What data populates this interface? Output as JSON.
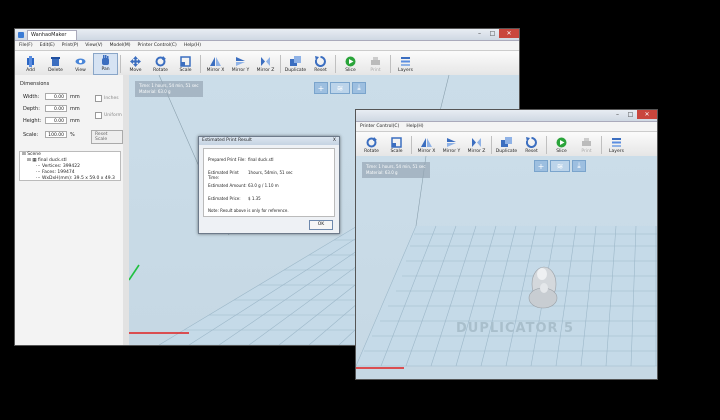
{
  "win1": {
    "title": "WanhaoMaker",
    "menu": [
      "File(F)",
      "Edit(E)",
      "Print(P)",
      "View(V)",
      "Model(M)",
      "Printer Control(C)",
      "Help(H)"
    ],
    "tools": [
      "Add",
      "Delete",
      "View",
      "Pan",
      "Move",
      "Rotate",
      "Scale",
      "Mirror X",
      "Mirror Y",
      "Mirror Z",
      "Duplicate",
      "Reset",
      "Slice",
      "Print",
      "Layers"
    ],
    "sidebar": {
      "heading": "Dimensions",
      "width_label": "Width:",
      "width_value": "0.00",
      "width_unit": "mm",
      "depth_label": "Depth:",
      "depth_value": "0.00",
      "depth_unit": "mm",
      "height_label": "Height:",
      "height_value": "0.00",
      "height_unit": "mm",
      "scale_label": "Scale:",
      "scale_value": "100.00",
      "scale_unit": "%",
      "inches_label": "Inches",
      "uniform_label": "Uniform",
      "reset_scale_label": "Reset Scale",
      "tree": [
        "Scene",
        "final duck.stl",
        "Vertices: 399422",
        "Faces: 199474",
        "WxDxH(mm): 39.5 x 59.0 x 49.3"
      ]
    },
    "info_line1": "Time: 1 hours, 54 min, 51 sec",
    "info_line2": "Material: 63.0 g"
  },
  "dialog": {
    "title": "Estimated Print Result",
    "close": "X",
    "file_label": "Prepared Print File:",
    "file_value": "final duck.stl",
    "time_label": "Estimated Print Time:",
    "time_value": "1hours, 54min, 51 sec",
    "amount_label": "Estimated Amount:",
    "amount_value": "63.0 g / 1.10 m",
    "price_label": "Estimated Price:",
    "price_value": "$ 1.35",
    "note": "Note: Result above is only for reference.",
    "ok_label": "OK"
  },
  "win2": {
    "menu": [
      "Printer Control(C)",
      "Help(H)"
    ],
    "tools": [
      "Rotate",
      "Scale",
      "Mirror X",
      "Mirror Y",
      "Mirror Z",
      "Duplicate",
      "Reset",
      "Slice",
      "Print",
      "Layers"
    ],
    "info_line1": "Time: 1 hours, 54 min, 51 sec",
    "info_line2": "Material: 63.0 g",
    "watermark": "DUPLICATOR 5",
    "watermark_partial": "DU"
  },
  "colors": {
    "grid_bg": "#c8dbe8",
    "grid_line": "#9db8c9",
    "axis_red": "#e02020",
    "axis_green": "#20c040",
    "slice_green": "#2aa43a"
  }
}
